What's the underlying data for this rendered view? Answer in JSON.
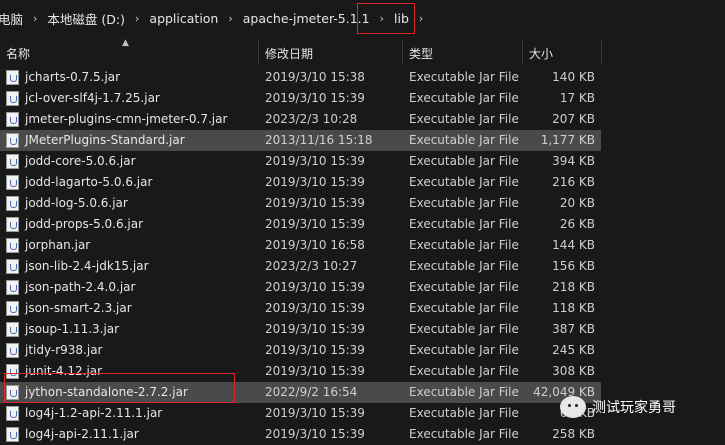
{
  "breadcrumb": {
    "items": [
      "电脑",
      "本地磁盘 (D:)",
      "application",
      "apache-jmeter-5.1.1",
      "lib"
    ],
    "separator": "›"
  },
  "columns": {
    "name": "名称",
    "date": "修改日期",
    "type": "类型",
    "size": "大小"
  },
  "files": [
    {
      "name": "jcharts-0.7.5.jar",
      "date": "2019/3/10 15:38",
      "type": "Executable Jar File",
      "size": "140 KB"
    },
    {
      "name": "jcl-over-slf4j-1.7.25.jar",
      "date": "2019/3/10 15:39",
      "type": "Executable Jar File",
      "size": "17 KB"
    },
    {
      "name": "jmeter-plugins-cmn-jmeter-0.7.jar",
      "date": "2023/2/3 10:28",
      "type": "Executable Jar File",
      "size": "207 KB"
    },
    {
      "name": "JMeterPlugins-Standard.jar",
      "date": "2013/11/16 15:18",
      "type": "Executable Jar File",
      "size": "1,177 KB",
      "highlighted": true
    },
    {
      "name": "jodd-core-5.0.6.jar",
      "date": "2019/3/10 15:39",
      "type": "Executable Jar File",
      "size": "394 KB"
    },
    {
      "name": "jodd-lagarto-5.0.6.jar",
      "date": "2019/3/10 15:39",
      "type": "Executable Jar File",
      "size": "216 KB"
    },
    {
      "name": "jodd-log-5.0.6.jar",
      "date": "2019/3/10 15:39",
      "type": "Executable Jar File",
      "size": "20 KB"
    },
    {
      "name": "jodd-props-5.0.6.jar",
      "date": "2019/3/10 15:39",
      "type": "Executable Jar File",
      "size": "26 KB"
    },
    {
      "name": "jorphan.jar",
      "date": "2019/3/10 16:58",
      "type": "Executable Jar File",
      "size": "144 KB"
    },
    {
      "name": "json-lib-2.4-jdk15.jar",
      "date": "2023/2/3 10:27",
      "type": "Executable Jar File",
      "size": "156 KB"
    },
    {
      "name": "json-path-2.4.0.jar",
      "date": "2019/3/10 15:39",
      "type": "Executable Jar File",
      "size": "218 KB"
    },
    {
      "name": "json-smart-2.3.jar",
      "date": "2019/3/10 15:39",
      "type": "Executable Jar File",
      "size": "118 KB"
    },
    {
      "name": "jsoup-1.11.3.jar",
      "date": "2019/3/10 15:39",
      "type": "Executable Jar File",
      "size": "387 KB"
    },
    {
      "name": "jtidy-r938.jar",
      "date": "2019/3/10 15:39",
      "type": "Executable Jar File",
      "size": "245 KB"
    },
    {
      "name": "junit-4.12.jar",
      "date": "2019/3/10 15:39",
      "type": "Executable Jar File",
      "size": "308 KB"
    },
    {
      "name": "jython-standalone-2.7.2.jar",
      "date": "2022/9/2 16:54",
      "type": "Executable Jar File",
      "size": "42,049 KB",
      "highlighted": true
    },
    {
      "name": "log4j-1.2-api-2.11.1.jar",
      "date": "2019/3/10 15:39",
      "type": "Executable Jar File",
      "size": "61 KB"
    },
    {
      "name": "log4j-api-2.11.1.jar",
      "date": "2019/3/10 15:39",
      "type": "Executable Jar File",
      "size": "258 KB"
    }
  ],
  "watermark": {
    "text": "测试玩家勇哥"
  },
  "colors": {
    "background": "#191919",
    "highlight_row": "#4a4a4a",
    "annotation_box": "#d62828"
  }
}
